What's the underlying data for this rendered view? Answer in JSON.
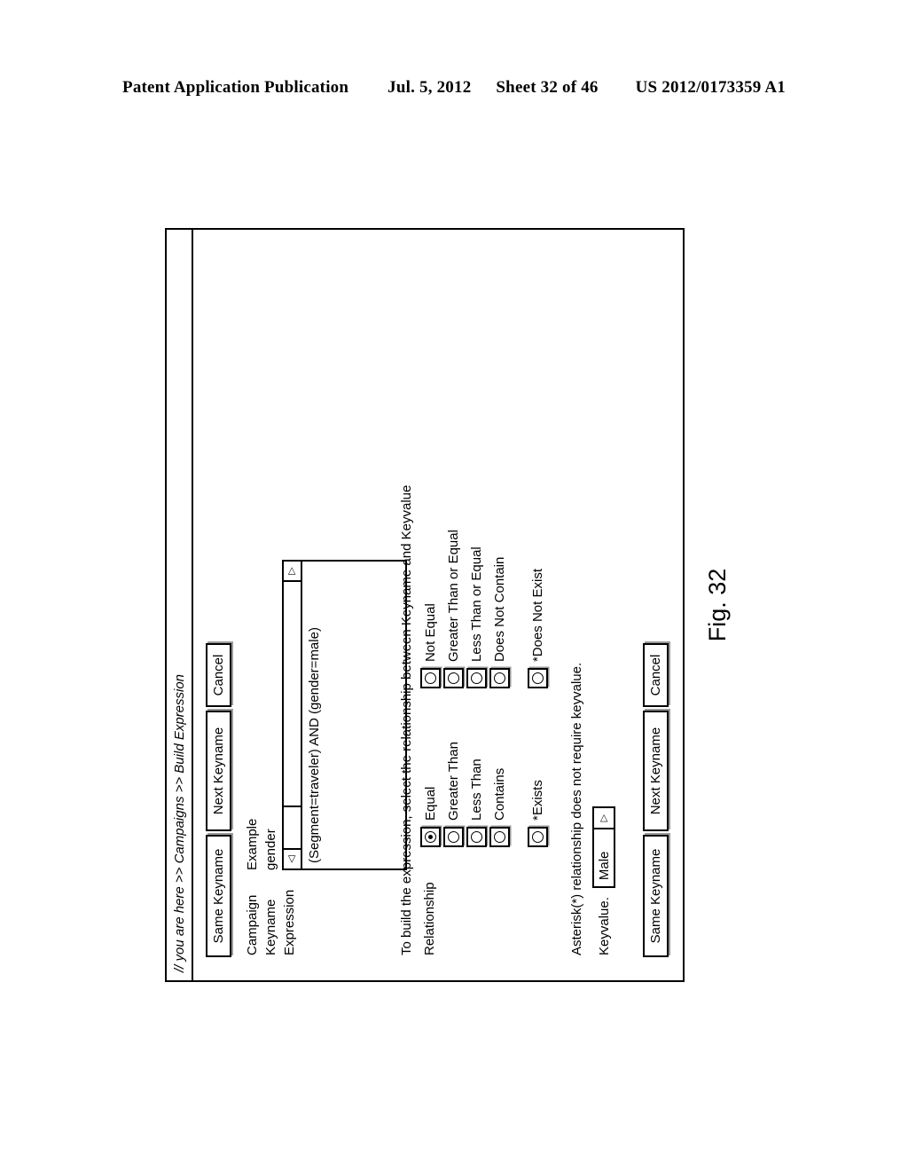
{
  "patent_header": {
    "publication": "Patent Application Publication",
    "date": "Jul. 5, 2012",
    "sheet": "Sheet 32 of 46",
    "number": "US 2012/0173359 A1"
  },
  "figure": {
    "caption": "Fig. 32"
  },
  "app": {
    "breadcrumb": "// you are here >> Campaigns >> Build Expression",
    "top_buttons": [
      {
        "label": "Same Keyname",
        "name": "same-keyname-button"
      },
      {
        "label": "Next Keyname",
        "name": "next-keyname-button"
      },
      {
        "label": "Cancel",
        "name": "cancel-button"
      }
    ],
    "form": {
      "campaign_label": "Campaign",
      "campaign_value": "Example",
      "keyname_label": "Keyname",
      "keyname_value": "gender",
      "expression_label": "Expression",
      "expression_value": "(Segment=traveler) AND (gender=male)",
      "scroll_left_icon": "◁",
      "scroll_right_icon": "▷"
    },
    "instructions": {
      "line1": "To build the expression, select the relationship between Keyname and Keyvalue",
      "relationship_label": "Relationship"
    },
    "relationship_options": {
      "column_left": [
        {
          "label": "Equal",
          "selected": true
        },
        {
          "label": "Greater Than",
          "selected": false
        },
        {
          "label": "Less Than",
          "selected": false
        },
        {
          "label": "Contains",
          "selected": false
        },
        {
          "label": "*Exists",
          "selected": false
        }
      ],
      "column_right": [
        {
          "label": "Not Equal",
          "selected": false
        },
        {
          "label": "Greater Than or Equal",
          "selected": false
        },
        {
          "label": "Less Than or Equal",
          "selected": false
        },
        {
          "label": "Does Not Contain",
          "selected": false
        },
        {
          "label": "*Does Not Exist",
          "selected": false
        }
      ]
    },
    "note": "Asterisk(*) relationship does not require keyvalue.",
    "keyvalue": {
      "label": "Keyvalue.",
      "value": "Male",
      "arrow_icon": "▷"
    },
    "bottom_buttons": [
      {
        "label": "Same Keyname",
        "name": "same-keyname-button-bottom"
      },
      {
        "label": "Next Keyname",
        "name": "next-keyname-button-bottom"
      },
      {
        "label": "Cancel",
        "name": "cancel-button-bottom"
      }
    ]
  }
}
